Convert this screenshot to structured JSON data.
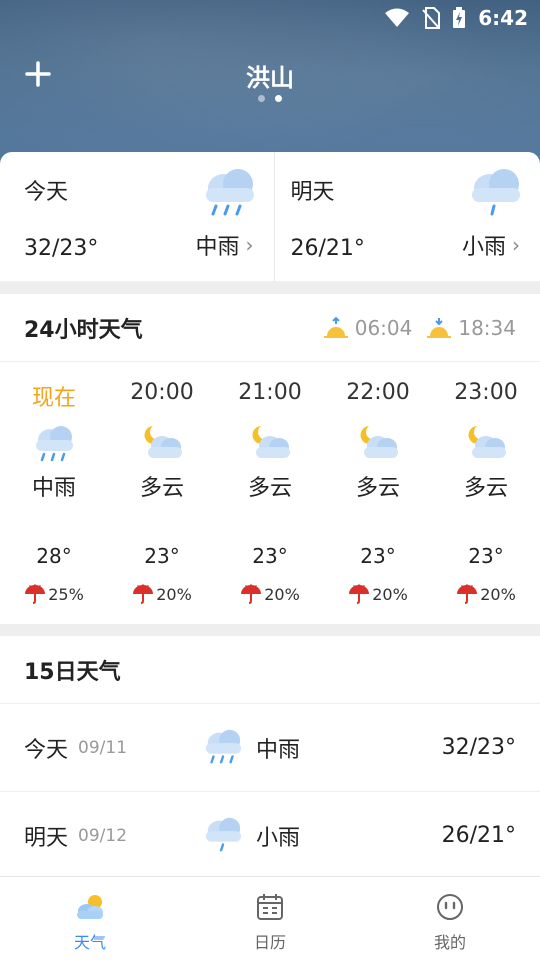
{
  "status": {
    "time": "6:42"
  },
  "header": {
    "city": "洪山"
  },
  "today": {
    "label": "今天",
    "temp": "32/23°",
    "condition": "中雨"
  },
  "tomorrow": {
    "label": "明天",
    "temp": "26/21°",
    "condition": "小雨"
  },
  "hourly": {
    "title": "24小时天气",
    "sunrise": "06:04",
    "sunset": "18:34",
    "items": [
      {
        "time": "现在",
        "condition": "中雨",
        "temp": "28°",
        "pop": "25%",
        "icon": "rain-cloud-icon"
      },
      {
        "time": "20:00",
        "condition": "多云",
        "temp": "23°",
        "pop": "20%",
        "icon": "moon-cloud-icon"
      },
      {
        "time": "21:00",
        "condition": "多云",
        "temp": "23°",
        "pop": "20%",
        "icon": "moon-cloud-icon"
      },
      {
        "time": "22:00",
        "condition": "多云",
        "temp": "23°",
        "pop": "20%",
        "icon": "moon-cloud-icon"
      },
      {
        "time": "23:00",
        "condition": "多云",
        "temp": "23°",
        "pop": "20%",
        "icon": "moon-cloud-icon"
      }
    ]
  },
  "daily": {
    "title": "15日天气",
    "items": [
      {
        "day": "今天",
        "date": "09/11",
        "condition": "中雨",
        "temp": "32/23°",
        "icon": "rain-cloud-icon"
      },
      {
        "day": "明天",
        "date": "09/12",
        "condition": "小雨",
        "temp": "26/21°",
        "icon": "light-rain-cloud-icon"
      }
    ]
  },
  "nav": {
    "weather": "天气",
    "calendar": "日历",
    "mine": "我的"
  },
  "colors": {
    "accent": "#3b8bf5",
    "now": "#f4a418",
    "umbrella": "#d9302b"
  }
}
